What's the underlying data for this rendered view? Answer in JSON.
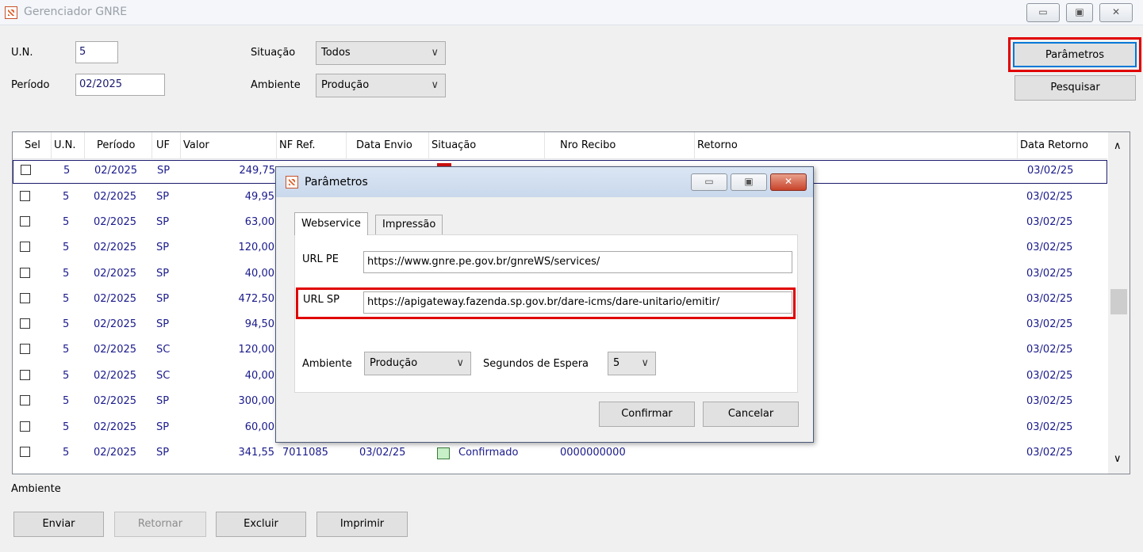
{
  "window": {
    "title": "Gerenciador GNRE",
    "min_glyph": "▭",
    "max_glyph": "▣",
    "close_glyph": "✕"
  },
  "filters": {
    "un_label": "U.N.",
    "un_value": "5",
    "periodo_label": "Período",
    "periodo_value": "02/2025",
    "situacao_label": "Situação",
    "situacao_value": "Todos",
    "ambiente_label": "Ambiente",
    "ambiente_value": "Produção",
    "chevron": "∨"
  },
  "buttons": {
    "parametros": "Parâmetros",
    "pesquisar": "Pesquisar"
  },
  "grid": {
    "headers": [
      "Sel",
      "U.N.",
      "Período",
      "UF",
      "Valor",
      "NF Ref.",
      "Data Envio",
      "Situação",
      "Nro Recibo",
      "Retorno",
      "Data Retorno"
    ],
    "rows": [
      {
        "un": "5",
        "periodo": "02/2025",
        "uf": "SP",
        "valor": "249,75",
        "data_retorno": "03/02/25"
      },
      {
        "un": "5",
        "periodo": "02/2025",
        "uf": "SP",
        "valor": "49,95",
        "data_retorno": "03/02/25"
      },
      {
        "un": "5",
        "periodo": "02/2025",
        "uf": "SP",
        "valor": "63,00",
        "data_retorno": "03/02/25"
      },
      {
        "un": "5",
        "periodo": "02/2025",
        "uf": "SP",
        "valor": "120,00",
        "data_retorno": "03/02/25"
      },
      {
        "un": "5",
        "periodo": "02/2025",
        "uf": "SP",
        "valor": "40,00",
        "data_retorno": "03/02/25"
      },
      {
        "un": "5",
        "periodo": "02/2025",
        "uf": "SP",
        "valor": "472,50",
        "data_retorno": "03/02/25"
      },
      {
        "un": "5",
        "periodo": "02/2025",
        "uf": "SP",
        "valor": "94,50",
        "data_retorno": "03/02/25"
      },
      {
        "un": "5",
        "periodo": "02/2025",
        "uf": "SC",
        "valor": "120,00",
        "data_retorno": "03/02/25"
      },
      {
        "un": "5",
        "periodo": "02/2025",
        "uf": "SC",
        "valor": "40,00",
        "data_retorno": "03/02/25"
      },
      {
        "un": "5",
        "periodo": "02/2025",
        "uf": "SP",
        "valor": "300,00",
        "data_retorno": "03/02/25"
      },
      {
        "un": "5",
        "periodo": "02/2025",
        "uf": "SP",
        "valor": "60,00",
        "data_retorno": "03/02/25"
      },
      {
        "un": "5",
        "periodo": "02/2025",
        "uf": "SP",
        "valor": "341,55",
        "nf_ref": "7011085",
        "data_envio": "03/02/25",
        "situacao": "Confirmado",
        "nro_recibo": "0000000000",
        "data_retorno": "03/02/25"
      }
    ],
    "scroll_up": "∧",
    "scroll_down": "∨"
  },
  "footer": {
    "ambiente_label": "Ambiente",
    "enviar": "Enviar",
    "retornar": "Retornar",
    "excluir": "Excluir",
    "imprimir": "Imprimir"
  },
  "dialog": {
    "title": "Parâmetros",
    "tabs": [
      "Webservice",
      "Impressão"
    ],
    "url_pe_label": "URL PE",
    "url_pe_value": "https://www.gnre.pe.gov.br/gnreWS/services/",
    "url_sp_label": "URL SP",
    "url_sp_value": "https://apigateway.fazenda.sp.gov.br/dare-icms/dare-unitario/emitir/",
    "ambiente_label": "Ambiente",
    "ambiente_value": "Produção",
    "segundos_label": "Segundos de Espera",
    "segundos_value": "5",
    "confirmar": "Confirmar",
    "cancelar": "Cancelar"
  },
  "colors": {
    "confirmed_box": "#c8f0c8",
    "error_box": "#d01010",
    "highlight": "#e00000"
  }
}
